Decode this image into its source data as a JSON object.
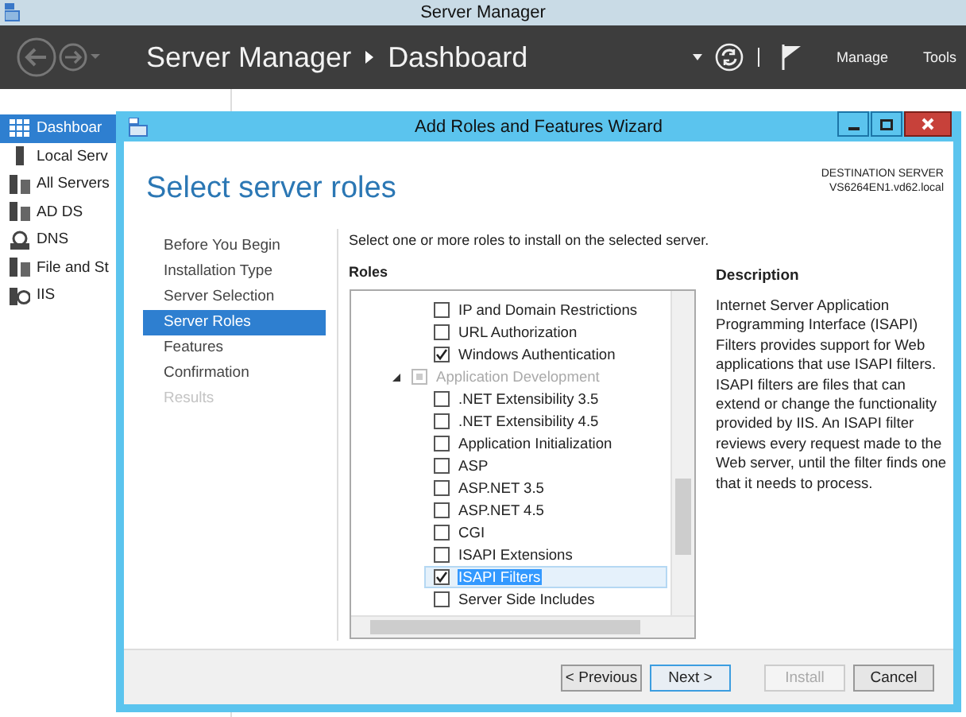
{
  "window": {
    "title": "Server Manager"
  },
  "header": {
    "breadcrumb": [
      "Server Manager",
      "Dashboard"
    ],
    "menus": [
      "Manage",
      "Tools"
    ]
  },
  "sidebar": {
    "items": [
      {
        "label": "Dashboar",
        "selected": true
      },
      {
        "label": "Local Serv",
        "selected": false
      },
      {
        "label": "All Servers",
        "selected": false
      },
      {
        "label": "AD DS",
        "selected": false
      },
      {
        "label": "DNS",
        "selected": false
      },
      {
        "label": "File and St",
        "selected": false
      },
      {
        "label": "IIS",
        "selected": false
      }
    ]
  },
  "wizard": {
    "title": "Add Roles and Features Wizard",
    "heading": "Select server roles",
    "destination_label": "DESTINATION SERVER",
    "destination_server": "VS6264EN1.vd62.local",
    "steps": [
      {
        "label": "Before You Begin",
        "selected": false,
        "disabled": false
      },
      {
        "label": "Installation Type",
        "selected": false,
        "disabled": false
      },
      {
        "label": "Server Selection",
        "selected": false,
        "disabled": false
      },
      {
        "label": "Server Roles",
        "selected": true,
        "disabled": false
      },
      {
        "label": "Features",
        "selected": false,
        "disabled": false
      },
      {
        "label": "Confirmation",
        "selected": false,
        "disabled": false
      },
      {
        "label": "Results",
        "selected": false,
        "disabled": true
      }
    ],
    "instruction": "Select one or more roles to install on the selected server.",
    "roles_label": "Roles",
    "roles": [
      {
        "kind": "feature",
        "label": "IP and Domain Restrictions",
        "checked": false,
        "selected": false
      },
      {
        "kind": "feature",
        "label": "URL Authorization",
        "checked": false,
        "selected": false
      },
      {
        "kind": "feature",
        "label": "Windows Authentication",
        "checked": true,
        "selected": false
      },
      {
        "kind": "group",
        "label": "Application Development",
        "checked": false,
        "selected": false
      },
      {
        "kind": "feature",
        "label": ".NET Extensibility 3.5",
        "checked": false,
        "selected": false
      },
      {
        "kind": "feature",
        "label": ".NET Extensibility 4.5",
        "checked": false,
        "selected": false
      },
      {
        "kind": "feature",
        "label": "Application Initialization",
        "checked": false,
        "selected": false
      },
      {
        "kind": "feature",
        "label": "ASP",
        "checked": false,
        "selected": false
      },
      {
        "kind": "feature",
        "label": "ASP.NET 3.5",
        "checked": false,
        "selected": false
      },
      {
        "kind": "feature",
        "label": "ASP.NET 4.5",
        "checked": false,
        "selected": false
      },
      {
        "kind": "feature",
        "label": "CGI",
        "checked": false,
        "selected": false
      },
      {
        "kind": "feature",
        "label": "ISAPI Extensions",
        "checked": false,
        "selected": false
      },
      {
        "kind": "feature",
        "label": "ISAPI Filters",
        "checked": true,
        "selected": true
      },
      {
        "kind": "feature",
        "label": "Server Side Includes",
        "checked": false,
        "selected": false
      }
    ],
    "description": {
      "title": "Description",
      "text": "Internet Server Application Programming Interface (ISAPI) Filters provides support for Web applications that use ISAPI filters. ISAPI filters are files that can extend or change the functionality provided by IIS. An ISAPI filter reviews every request made to the Web server, until the filter finds one that it needs to process."
    },
    "buttons": [
      {
        "label": "< Previous",
        "disabled": false,
        "default": false
      },
      {
        "label": "Next >",
        "disabled": false,
        "default": true
      },
      {
        "label": "Install",
        "disabled": true,
        "default": false
      },
      {
        "label": "Cancel",
        "disabled": false,
        "default": false
      }
    ]
  }
}
